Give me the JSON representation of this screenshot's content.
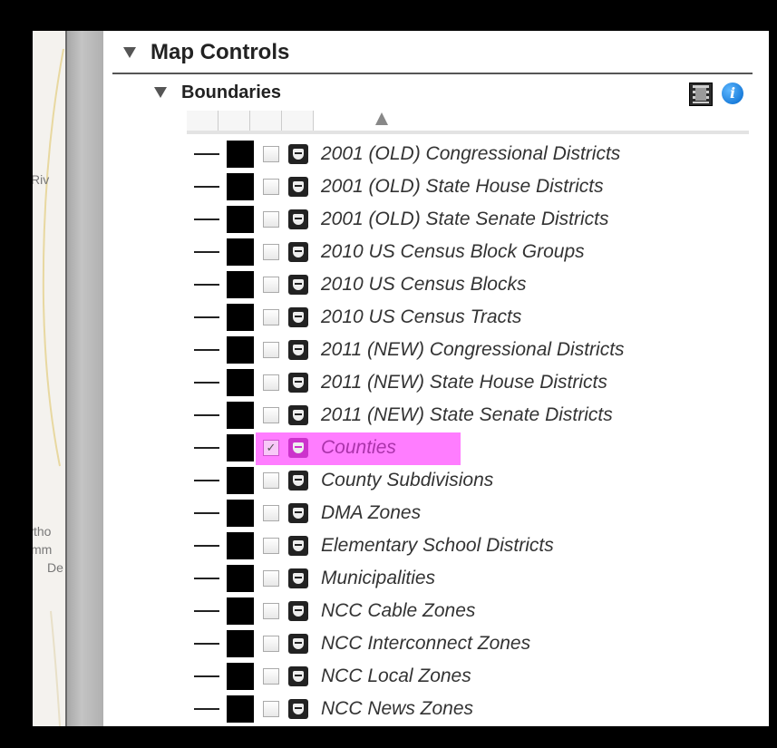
{
  "map": {
    "labels": [
      "Riv",
      "vtho",
      "mm",
      "De"
    ]
  },
  "panel": {
    "title": "Map Controls",
    "section": {
      "title": "Boundaries",
      "icons": {
        "film": "film-icon",
        "info": "info-icon"
      }
    },
    "layers": [
      {
        "label": "2001 (OLD) Congressional Districts",
        "checked": false
      },
      {
        "label": "2001 (OLD) State House Districts",
        "checked": false
      },
      {
        "label": "2001 (OLD) State Senate Districts",
        "checked": false
      },
      {
        "label": "2010 US Census Block Groups",
        "checked": false
      },
      {
        "label": "2010 US Census Blocks",
        "checked": false
      },
      {
        "label": "2010 US Census Tracts",
        "checked": false
      },
      {
        "label": "2011 (NEW) Congressional Districts",
        "checked": false
      },
      {
        "label": "2011 (NEW) State House Districts",
        "checked": false
      },
      {
        "label": "2011 (NEW) State Senate Districts",
        "checked": false
      },
      {
        "label": "Counties",
        "checked": true,
        "highlighted": true,
        "check_glyph": "✓"
      },
      {
        "label": "County Subdivisions",
        "checked": false
      },
      {
        "label": "DMA Zones",
        "checked": false
      },
      {
        "label": "Elementary School Districts",
        "checked": false
      },
      {
        "label": "Municipalities",
        "checked": false
      },
      {
        "label": "NCC Cable Zones",
        "checked": false
      },
      {
        "label": "NCC Interconnect Zones",
        "checked": false
      },
      {
        "label": "NCC Local Zones",
        "checked": false
      },
      {
        "label": "NCC News Zones",
        "checked": false
      }
    ]
  },
  "colors": {
    "highlight": "#ff66ff",
    "swatch": "#000000",
    "frame": "#000000"
  }
}
